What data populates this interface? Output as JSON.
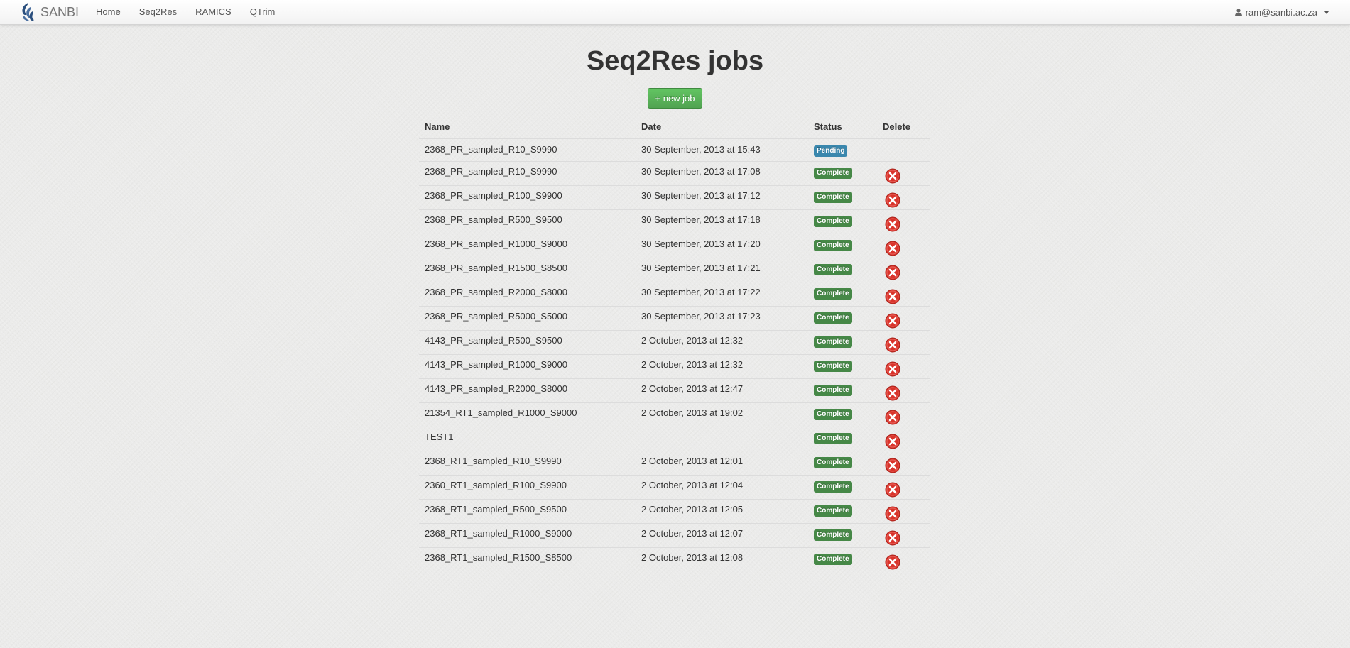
{
  "navbar": {
    "brand": "SANBI",
    "links": [
      "Home",
      "Seq2Res",
      "RAMICS",
      "QTrim"
    ],
    "user": "ram@sanbi.ac.za"
  },
  "page": {
    "title": "Seq2Res jobs",
    "new_job_label": "+ new job"
  },
  "table": {
    "headers": [
      "Name",
      "Date",
      "Status",
      "Delete"
    ],
    "rows": [
      {
        "name": "2368_PR_sampled_R10_S9990",
        "date": "30 September, 2013 at 15:43",
        "status": "Pending",
        "deletable": false
      },
      {
        "name": "2368_PR_sampled_R10_S9990",
        "date": "30 September, 2013 at 17:08",
        "status": "Complete",
        "deletable": true
      },
      {
        "name": "2368_PR_sampled_R100_S9900",
        "date": "30 September, 2013 at 17:12",
        "status": "Complete",
        "deletable": true
      },
      {
        "name": "2368_PR_sampled_R500_S9500",
        "date": "30 September, 2013 at 17:18",
        "status": "Complete",
        "deletable": true
      },
      {
        "name": "2368_PR_sampled_R1000_S9000",
        "date": "30 September, 2013 at 17:20",
        "status": "Complete",
        "deletable": true
      },
      {
        "name": "2368_PR_sampled_R1500_S8500",
        "date": "30 September, 2013 at 17:21",
        "status": "Complete",
        "deletable": true
      },
      {
        "name": "2368_PR_sampled_R2000_S8000",
        "date": "30 September, 2013 at 17:22",
        "status": "Complete",
        "deletable": true
      },
      {
        "name": "2368_PR_sampled_R5000_S5000",
        "date": "30 September, 2013 at 17:23",
        "status": "Complete",
        "deletable": true
      },
      {
        "name": "4143_PR_sampled_R500_S9500",
        "date": "2 October, 2013 at 12:32",
        "status": "Complete",
        "deletable": true
      },
      {
        "name": "4143_PR_sampled_R1000_S9000",
        "date": "2 October, 2013 at 12:32",
        "status": "Complete",
        "deletable": true
      },
      {
        "name": "4143_PR_sampled_R2000_S8000",
        "date": "2 October, 2013 at 12:47",
        "status": "Complete",
        "deletable": true
      },
      {
        "name": "21354_RT1_sampled_R1000_S9000",
        "date": "2 October, 2013 at 19:02",
        "status": "Complete",
        "deletable": true
      },
      {
        "name": "TEST1",
        "date": "",
        "status": "Complete",
        "deletable": true
      },
      {
        "name": "2368_RT1_sampled_R10_S9990",
        "date": "2 October, 2013 at 12:01",
        "status": "Complete",
        "deletable": true
      },
      {
        "name": "2360_RT1_sampled_R100_S9900",
        "date": "2 October, 2013 at 12:04",
        "status": "Complete",
        "deletable": true
      },
      {
        "name": "2368_RT1_sampled_R500_S9500",
        "date": "2 October, 2013 at 12:05",
        "status": "Complete",
        "deletable": true
      },
      {
        "name": "2368_RT1_sampled_R1000_S9000",
        "date": "2 October, 2013 at 12:07",
        "status": "Complete",
        "deletable": true
      },
      {
        "name": "2368_RT1_sampled_R1500_S8500",
        "date": "2 October, 2013 at 12:08",
        "status": "Complete",
        "deletable": true
      }
    ]
  },
  "icons": {
    "brand": "sanbi-logo-icon",
    "user": "user-icon",
    "caret": "caret-down-icon",
    "delete": "delete-icon"
  },
  "colors": {
    "complete": "#468847",
    "pending": "#3a87ad",
    "new_job_button": "#51a351",
    "delete": "#d9342b"
  }
}
